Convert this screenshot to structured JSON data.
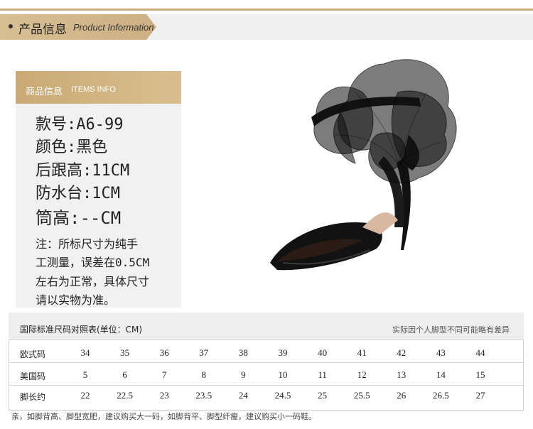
{
  "header": {
    "title_cn": "产品信息",
    "title_en": "Product Information"
  },
  "info": {
    "tab_cn": "商品信息",
    "tab_en": "ITEMS INFO",
    "specs": [
      "款号:A6-99",
      "颜色:黑色",
      "后跟高:11CM",
      "防水台:1CM",
      "筒高:--CM"
    ],
    "note_lines": [
      "注：所标尺寸为纯手",
      "工测量，误差在0.5CM",
      "左右为正常，具体尺寸",
      "请以实物为准。"
    ]
  },
  "product_image": {
    "subject": "black suede open-toe stiletto sandal with oversized tulle bow",
    "color": "#111111"
  },
  "size_table": {
    "title": "国际标准尺码对照表(单位：CM)",
    "note": "实际因个人脚型不同可能略有差异",
    "rows": [
      {
        "label": "欧式码",
        "values": [
          "34",
          "35",
          "36",
          "37",
          "38",
          "39",
          "40",
          "41",
          "42",
          "43",
          "44"
        ]
      },
      {
        "label": "美国码",
        "values": [
          "5",
          "6",
          "7",
          "8",
          "9",
          "10",
          "11",
          "12",
          "13",
          "14",
          "15"
        ]
      },
      {
        "label": "脚长约",
        "values": [
          "22",
          "22.5",
          "23",
          "23.5",
          "24",
          "24.5",
          "25",
          "25.5",
          "26",
          "26.5",
          "27"
        ]
      }
    ]
  },
  "footer_note": "亲，如脚背高、脚型宽肥，建议购买大一码，如脚背平、脚型纤瘦，建议购买小一码鞋。",
  "colors": {
    "accent": "#cdb083",
    "band": "#f0f0f0",
    "card": "#f1f1f1"
  }
}
